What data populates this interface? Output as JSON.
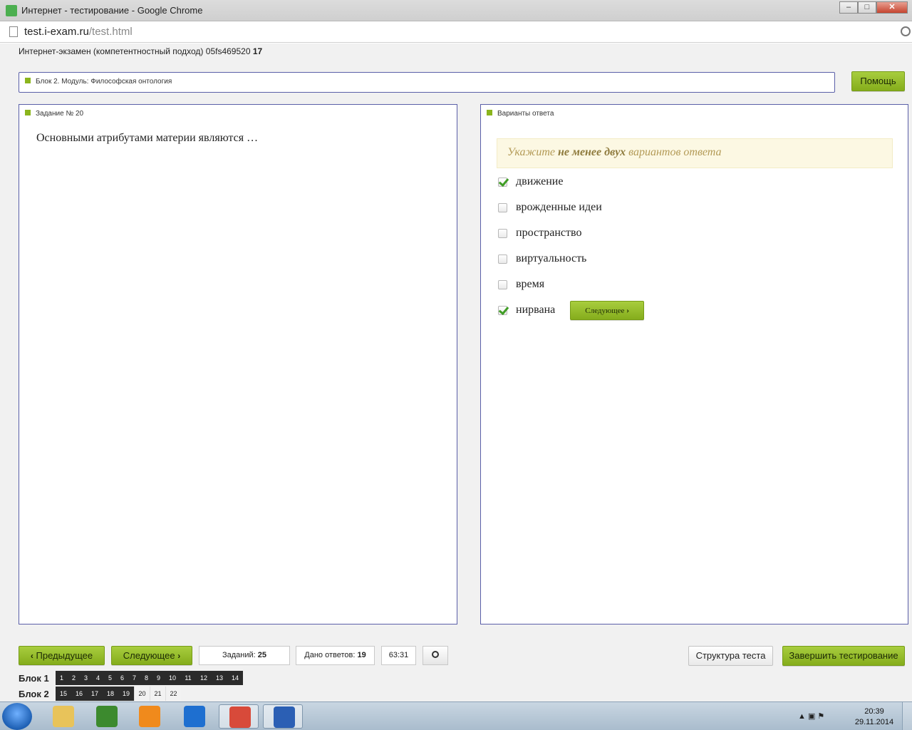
{
  "window": {
    "title": "Интернет - тестирование - Google Chrome",
    "controls": {
      "minimize": "–",
      "maximize": "□",
      "close": "✕"
    }
  },
  "browser": {
    "url_host": "test.i-exam.ru",
    "url_path": "/test.html"
  },
  "exam": {
    "header_text": "Интернет-экзамен (компетентностный подход) 05fs469520",
    "header_number": "17",
    "block_title": "Блок 2. Модуль: Философская онтология",
    "help_label": "Помощь"
  },
  "task": {
    "head": "Задание № 20",
    "question": "Основными атрибутами материи являются …"
  },
  "answers": {
    "head": "Варианты ответа",
    "hint_pre": "Укажите ",
    "hint_bold": "не менее двух",
    "hint_post": " вариантов ответа",
    "options": [
      {
        "label": "движение",
        "checked": true
      },
      {
        "label": "врожденные идеи",
        "checked": false
      },
      {
        "label": "пространство",
        "checked": false
      },
      {
        "label": "виртуальность",
        "checked": false
      },
      {
        "label": "время",
        "checked": false
      },
      {
        "label": "нирвана",
        "checked": true
      }
    ],
    "next_inline_label": "Следующее"
  },
  "footer": {
    "prev_label": "Предыдущее",
    "next_label": "Следующее",
    "tasks_label": "Заданий:",
    "tasks_value": "25",
    "answered_label": "Дано ответов:",
    "answered_value": "19",
    "timer": "63:31",
    "structure_label": "Структура теста",
    "finish_label": "Завершить тестирование"
  },
  "blocks": [
    {
      "label": "Блок 1",
      "items": [
        {
          "n": "1",
          "done": true
        },
        {
          "n": "2",
          "done": true
        },
        {
          "n": "3",
          "done": true
        },
        {
          "n": "4",
          "done": true
        },
        {
          "n": "5",
          "done": true
        },
        {
          "n": "6",
          "done": true
        },
        {
          "n": "7",
          "done": true
        },
        {
          "n": "8",
          "done": true
        },
        {
          "n": "9",
          "done": true
        },
        {
          "n": "10",
          "done": true
        },
        {
          "n": "11",
          "done": true
        },
        {
          "n": "12",
          "done": true
        },
        {
          "n": "13",
          "done": true
        },
        {
          "n": "14",
          "done": true
        }
      ]
    },
    {
      "label": "Блок 2",
      "items": [
        {
          "n": "15",
          "done": true
        },
        {
          "n": "16",
          "done": true
        },
        {
          "n": "17",
          "done": true
        },
        {
          "n": "18",
          "done": true
        },
        {
          "n": "19",
          "done": true
        },
        {
          "n": "20",
          "done": false
        },
        {
          "n": "21",
          "done": false
        },
        {
          "n": "22",
          "done": false
        }
      ]
    }
  ],
  "taskbar": {
    "apps": [
      {
        "name": "explorer-icon",
        "color": "#e8c35a"
      },
      {
        "name": "utorrent-icon",
        "color": "#3c8a2e"
      },
      {
        "name": "media-player-icon",
        "color": "#f08a1c"
      },
      {
        "name": "mail-agent-icon",
        "color": "#1e6fd0"
      },
      {
        "name": "chrome-icon",
        "color": "#d84a3a"
      },
      {
        "name": "word-icon",
        "color": "#2b5fb4"
      }
    ],
    "time": "20:39",
    "date": "29.11.2014"
  },
  "colors": {
    "accent_green": "#8bb51d",
    "panel_border": "#5a5fa8",
    "hint_bg": "#fcf8e3"
  }
}
